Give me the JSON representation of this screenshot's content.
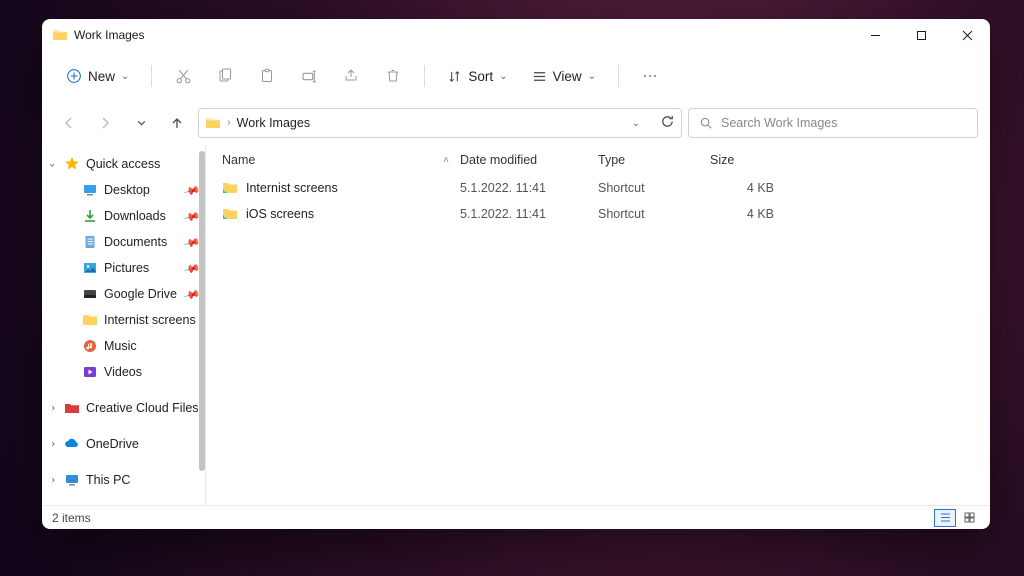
{
  "window": {
    "title": "Work Images"
  },
  "toolbar": {
    "new_label": "New",
    "sort_label": "Sort",
    "view_label": "View"
  },
  "address": {
    "crumb": "Work Images"
  },
  "search": {
    "placeholder": "Search Work Images"
  },
  "sidebar": {
    "quick_access": "Quick access",
    "items": [
      {
        "label": "Desktop",
        "icon": "desktop",
        "pinned": true
      },
      {
        "label": "Downloads",
        "icon": "download",
        "pinned": true
      },
      {
        "label": "Documents",
        "icon": "document",
        "pinned": true
      },
      {
        "label": "Pictures",
        "icon": "pictures",
        "pinned": true
      },
      {
        "label": "Google Drive",
        "icon": "gdrive",
        "pinned": true
      },
      {
        "label": "Internist screens",
        "icon": "folder",
        "pinned": false
      },
      {
        "label": "Music",
        "icon": "music",
        "pinned": false
      },
      {
        "label": "Videos",
        "icon": "videos",
        "pinned": false
      }
    ],
    "creative_cloud": "Creative Cloud Files",
    "onedrive": "OneDrive",
    "this_pc": "This PC"
  },
  "columns": {
    "name": "Name",
    "date": "Date modified",
    "type": "Type",
    "size": "Size"
  },
  "files": [
    {
      "name": "Internist screens",
      "date": "5.1.2022. 11:41",
      "type": "Shortcut",
      "size": "4 KB"
    },
    {
      "name": "iOS screens",
      "date": "5.1.2022. 11:41",
      "type": "Shortcut",
      "size": "4 KB"
    }
  ],
  "status": {
    "items": "2 items"
  }
}
